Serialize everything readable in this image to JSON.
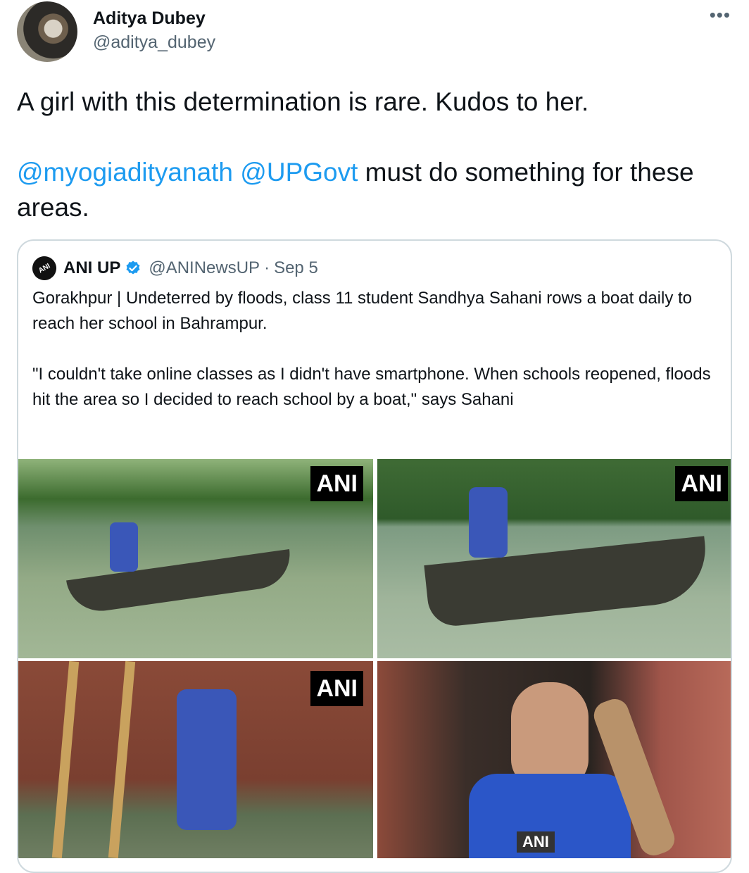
{
  "author": {
    "name": "Aditya Dubey",
    "handle": "@aditya_dubey"
  },
  "more_label": "•••",
  "tweet": {
    "line1": "A girl with this determination is rare. Kudos to her.",
    "mention1": "@myogiadityanath",
    "mention2": "@UPGovt",
    "line2_rest": " must do something for these areas."
  },
  "quoted": {
    "avatar_text": "ANI",
    "name": "ANI UP",
    "handle": "@ANINewsUP",
    "separator": "·",
    "date": "Sep 5",
    "para1": "Gorakhpur | Undeterred by floods, class 11 student Sandhya Sahani rows a boat daily to reach her school in Bahrampur.",
    "para2": "\"I couldn't take online classes as I didn't have smartphone. When schools reopened, floods hit the area so I decided to reach school by a boat,\" says Sahani"
  },
  "photos": {
    "watermark": "ANI",
    "mic_label": "ANI"
  },
  "colors": {
    "link": "#1d9bf0",
    "muted": "#536471",
    "border": "#cfd9de"
  }
}
